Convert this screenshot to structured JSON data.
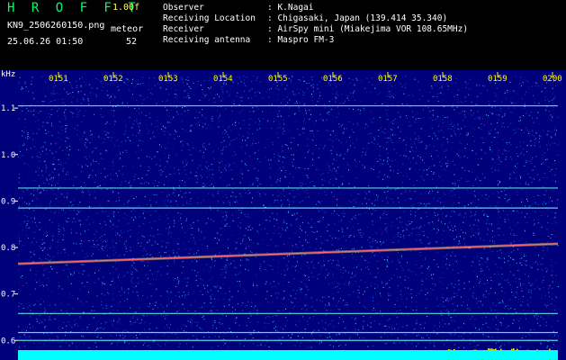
{
  "header": {
    "app_title": "H R O F F T",
    "version": "1.00f",
    "filename": "KN9_2506260150.png",
    "meteor_label": "meteor",
    "datetime": "25.06.26 01:50",
    "meteor_count": "52",
    "info": [
      {
        "label": "Observer",
        "value": ": K.Nagai"
      },
      {
        "label": "Receiving Location",
        "value": ": Chigasaki, Japan (139.414 35.340)"
      },
      {
        "label": "Receiver",
        "value": ": AirSpy mini (Miakejima VOR 108.65MHz)"
      },
      {
        "label": "Receiving antenna",
        "value": ": Maspro FM-3"
      }
    ]
  },
  "chart_data": {
    "type": "heatmap",
    "ylabel": "kHz",
    "x_ticks": [
      "0151",
      "0152",
      "0153",
      "0154",
      "0155",
      "0156",
      "0157",
      "0158",
      "0159",
      "0200"
    ],
    "y_ticks": [
      "1.1",
      "1.0",
      "0.9",
      "0.8",
      "0.7",
      "0.6"
    ],
    "ylim": [
      0.585,
      1.17
    ],
    "carriers": [
      {
        "freq": 1.105
      },
      {
        "freq": 0.928
      },
      {
        "freq": 0.885
      },
      {
        "freq": 0.658
      },
      {
        "freq": 0.617
      },
      {
        "freq": 0.6
      }
    ],
    "drift_line": {
      "start_freq": 0.765,
      "end_freq": 0.808
    },
    "colors": {
      "background": "#00007a",
      "noise": "#3050ff",
      "carrier": "#66ffee",
      "drift": "#ff6666",
      "tick": "#ffff00",
      "meter_low": "#00ffff",
      "meter_high": "#ffff00"
    }
  }
}
